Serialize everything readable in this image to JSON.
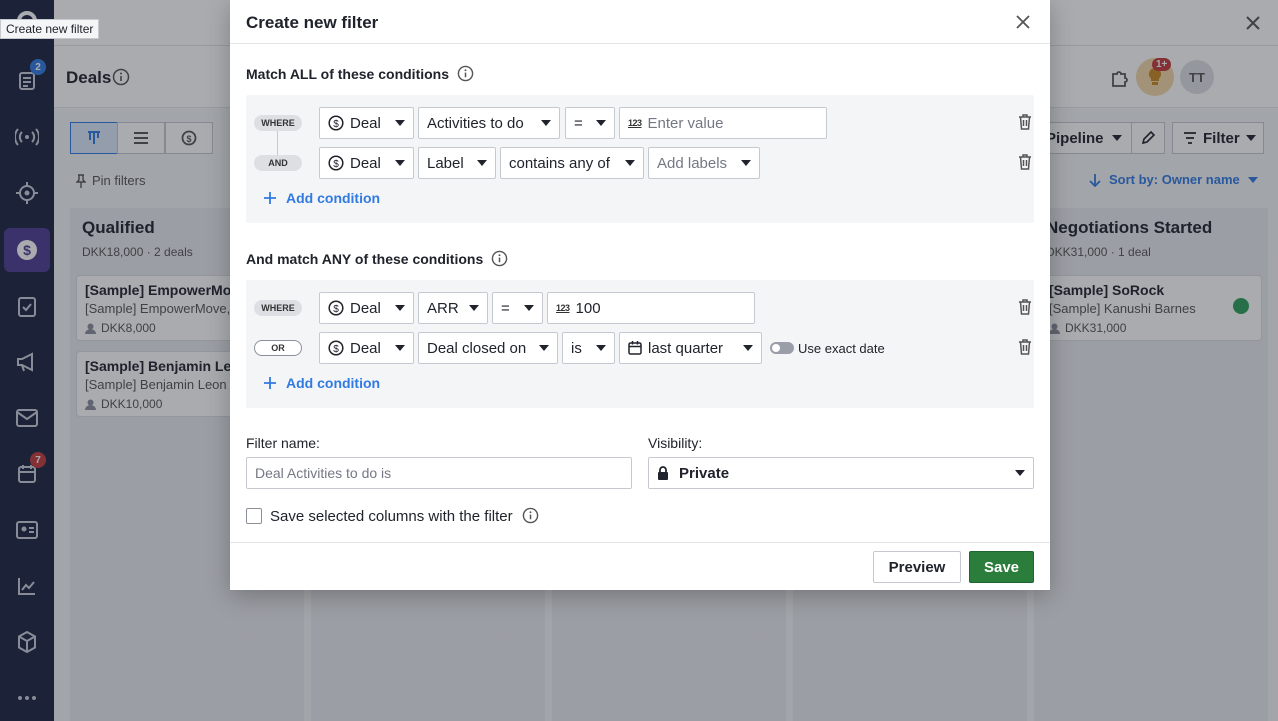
{
  "tooltip": "Create new filter",
  "nav": {
    "badges": {
      "leads": "2",
      "calendar": "7"
    },
    "icons": [
      "leads-icon",
      "signal-icon",
      "target-icon",
      "deals-icon",
      "tasks-icon",
      "campaigns-icon",
      "mail-icon",
      "calendar-icon",
      "contacts-icon",
      "insights-icon",
      "products-icon",
      "more-icon"
    ]
  },
  "header": {
    "page_title": "Deals",
    "bulb_badge": "1+",
    "avatar_initials": "TT"
  },
  "toolbar": {
    "pipeline_label": "Pipeline",
    "filter_label": "Filter",
    "pin_filters": "Pin filters",
    "sort_by": "Sort by: Owner name"
  },
  "columns": [
    {
      "title": "Qualified",
      "summary": "DKK18,000 · 2 deals",
      "cards": [
        {
          "title": "[Sample] EmpowerMove",
          "subtitle": "[Sample] EmpowerMove,",
          "amount": "DKK8,000"
        },
        {
          "title": "[Sample] Benjamin Leon",
          "subtitle": "[Sample] Benjamin Leon",
          "amount": "DKK10,000"
        }
      ]
    },
    {
      "title": "Negotiations Started",
      "summary": "DKK31,000 · 1 deal",
      "cards": [
        {
          "title": "[Sample] SoRock",
          "subtitle": "[Sample] Kanushi Barnes",
          "amount": "DKK31,000"
        }
      ]
    }
  ],
  "modal": {
    "title": "Create new filter",
    "all_section": {
      "label": "Match ALL of these conditions",
      "rows": [
        {
          "connector": "WHERE",
          "entity": "Deal",
          "field": "Activities to do",
          "operator": "=",
          "value_placeholder": "Enter value"
        },
        {
          "connector": "AND",
          "entity": "Deal",
          "field": "Label",
          "operator": "contains any of",
          "value_placeholder": "Add labels"
        }
      ],
      "add_condition": "Add condition"
    },
    "any_section": {
      "label": "And match ANY of these conditions",
      "rows": [
        {
          "connector": "WHERE",
          "entity": "Deal",
          "field": "ARR",
          "operator": "=",
          "value": "100"
        },
        {
          "connector": "OR",
          "entity": "Deal",
          "field": "Deal closed on",
          "operator": "is",
          "value": "last quarter",
          "toggle_label": "Use exact date"
        }
      ],
      "add_condition": "Add condition"
    },
    "filter_name": {
      "label": "Filter name:",
      "placeholder": "Deal Activities to do is"
    },
    "visibility": {
      "label": "Visibility:",
      "value": "Private"
    },
    "save_columns_label": "Save selected columns with the filter",
    "preview_label": "Preview",
    "save_label": "Save"
  },
  "colors": {
    "primary_green": "#2a7d3b",
    "link_blue": "#317ae2",
    "nav_bg": "#1c2340",
    "nav_active": "#4e3d92"
  }
}
